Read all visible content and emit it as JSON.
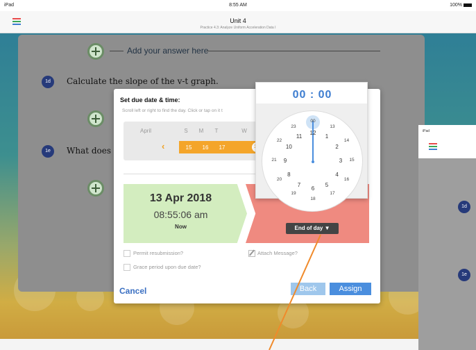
{
  "status_bar": {
    "device": "iPad",
    "time": "8:55 AM",
    "battery": "100%"
  },
  "title_bar": {
    "title": "Unit 4",
    "subtitle": "Practice 4.3: Analyze Uniform Acceleration Data I"
  },
  "question_card": {
    "add_answer": "Add your answer here",
    "q1d": {
      "badge": "1d",
      "text": "Calculate the slope of the v-t graph."
    },
    "q1e": {
      "badge": "1e",
      "text": "What does"
    }
  },
  "right_panel": {
    "device": "iPad",
    "badge_1": "1d",
    "badge_2": "1e"
  },
  "dialog": {
    "title": "Set due date & time:",
    "instruction": "Scroll left or right to find the day. Click or tap on it t",
    "calendar": {
      "month": "April",
      "weekdays": [
        "S",
        "M",
        "T",
        "W"
      ],
      "dates": [
        "15",
        "16",
        "17",
        "18"
      ]
    },
    "now_date": "13 Apr 2018",
    "now_time": "08:55:06 am",
    "now_label": "Now",
    "end_of_day": "End of day ▼",
    "permit_resubmission": "Permit resubmission?",
    "grace_period": "Grace period upon due date?",
    "attach_message": "Attach Message?",
    "cancel": "Cancel",
    "back": "Back",
    "assign": "Assign"
  },
  "time_picker": {
    "hours": "00",
    "separator": ":",
    "minutes": "00",
    "inner_ring": [
      "12",
      "1",
      "2",
      "3",
      "4",
      "5",
      "6",
      "7",
      "8",
      "9",
      "10",
      "11"
    ],
    "outer_ring": [
      "00",
      "13",
      "14",
      "15",
      "16",
      "17",
      "18",
      "19",
      "20",
      "21",
      "22",
      "23"
    ]
  },
  "colors": {
    "accent_blue": "#4a8ede",
    "calendar_orange": "#f4a52a",
    "now_green": "#d3edbf",
    "end_red": "#ef8a80",
    "annotation_orange": "#f08a2a"
  },
  "icons": {
    "menu": "menu-icon",
    "add": "plus-icon",
    "back_chevron": "chevron-left-icon",
    "attach": "pencil-icon"
  }
}
